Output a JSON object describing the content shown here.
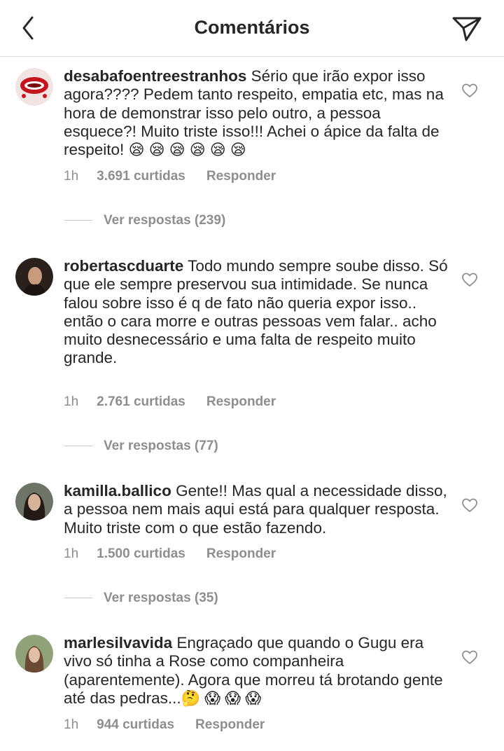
{
  "header": {
    "title": "Comentários",
    "back_icon": "chevron-left-icon",
    "send_icon": "direct-send-icon"
  },
  "comments": [
    {
      "username": "desabafoentreestranhos",
      "text": " Sério que irão expor isso agora???? Pedem tanto respeito, empatia etc, mas na hora de demonstrar isso pelo outro, a pessoa esquece?! Muito triste isso!!! Achei o ápice da falta de respeito! ",
      "emojis": "😪 😪 😪 😪 😪 😪",
      "time": "1h",
      "likes": "3.691 curtidas",
      "reply": "Responder",
      "view_replies": "Ver respostas (239)"
    },
    {
      "username": "robertascduarte",
      "text": " Todo mundo sempre soube disso. Só que ele sempre preservou sua intimidade. Se nunca falou sobre isso é q de fato não queria expor isso.. então o cara morre e outras pessoas vem falar.. acho muito desnecessário e uma falta de respeito muito grande.",
      "emojis": "",
      "time": "1h",
      "likes": "2.761 curtidas",
      "reply": "Responder",
      "view_replies": "Ver respostas (77)"
    },
    {
      "username": "kamilla.ballico",
      "text": " Gente!! Mas qual a necessidade disso, a pessoa nem mais aqui está para qualquer resposta. Muito triste com o que estão fazendo.",
      "emojis": "",
      "time": "1h",
      "likes": "1.500 curtidas",
      "reply": "Responder",
      "view_replies": "Ver respostas (35)"
    },
    {
      "username": "marlesilvavida",
      "text": " Engraçado que quando o Gugu era vivo só tinha a Rose como companheira (aparentemente). Agora que morreu tá brotando gente até das pedras...",
      "emojis": "🤔 😱 😱 😱",
      "time": "1h",
      "likes": "944 curtidas",
      "reply": "Responder",
      "view_replies": ""
    }
  ],
  "icons": {
    "like": "heart-outline-icon"
  },
  "colors": {
    "text": "#262626",
    "secondary": "#8e8e8e",
    "divider": "#dbdbdb"
  }
}
